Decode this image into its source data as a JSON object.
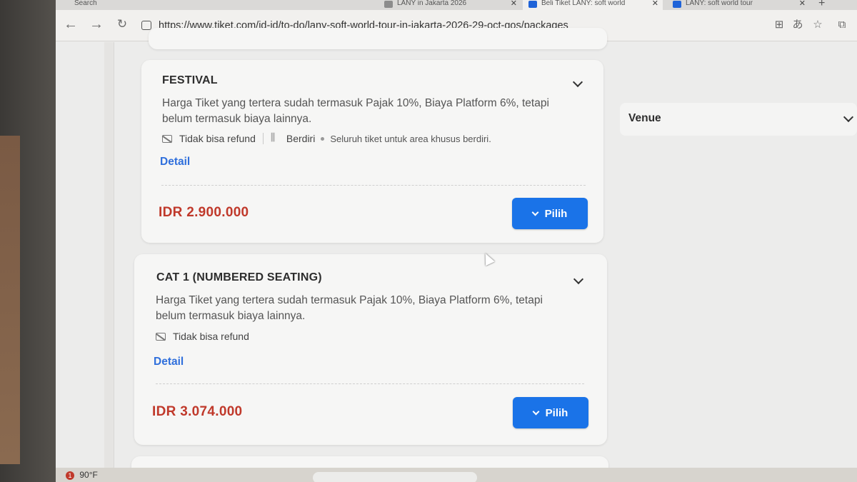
{
  "browser": {
    "tabs": [
      {
        "label": "Search"
      },
      {
        "label": "LANY in Jakarta 2026"
      },
      {
        "label": "Beli Tiket LANY: soft world"
      },
      {
        "label": "LANY: soft world tour"
      }
    ],
    "url": "https://www.tiket.com/id-id/to-do/lany-soft-world-tour-in-jakarta-2026-29-oct-gos/packages"
  },
  "packages": [
    {
      "title": "FESTIVAL",
      "description": "Harga Tiket yang tertera sudah termasuk Pajak 10%, Biaya Platform 6%, tetapi belum termasuk biaya lainnya.",
      "refund": "Tidak bisa refund",
      "seating": "Berdiri",
      "seating_note": "Seluruh tiket untuk area khusus berdiri.",
      "detail_label": "Detail",
      "price": "IDR 2.900.000",
      "button_label": "Pilih"
    },
    {
      "title": "CAT 1 (NUMBERED SEATING)",
      "description": "Harga Tiket yang tertera sudah termasuk Pajak 10%, Biaya Platform 6%, tetapi belum termasuk biaya lainnya.",
      "refund": "Tidak bisa refund",
      "detail_label": "Detail",
      "price": "IDR 3.074.000",
      "button_label": "Pilih"
    }
  ],
  "sidebar": {
    "venue_label": "Venue"
  },
  "taskbar": {
    "weather": "90°F",
    "notification_count": "1"
  }
}
